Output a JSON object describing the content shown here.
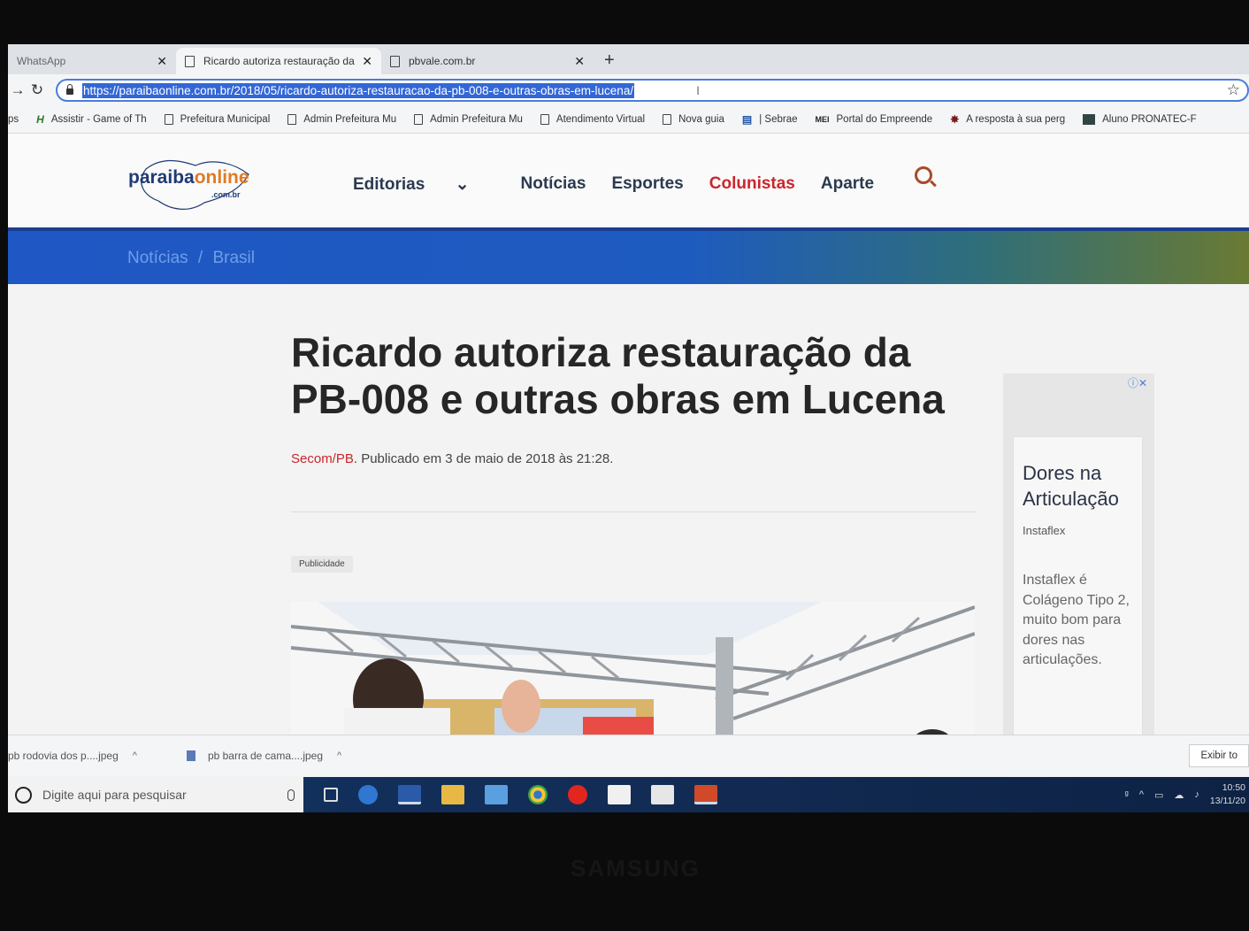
{
  "tabs": [
    {
      "label": "WhatsApp",
      "active": false
    },
    {
      "label": "Ricardo autoriza restauração da P",
      "active": true
    },
    {
      "label": "pbvale.com.br",
      "active": false
    }
  ],
  "address_bar": {
    "url": "https://paraibaonline.com.br/2018/05/ricardo-autoriza-restauracao-da-pb-008-e-outras-obras-em-lucena/"
  },
  "bookmarks": [
    {
      "icon": "apps-icon",
      "label": "ps"
    },
    {
      "icon": "h-icon",
      "label": "Assistir - Game of Th"
    },
    {
      "icon": "page-icon",
      "label": "Prefeitura Municipal"
    },
    {
      "icon": "page-icon",
      "label": "Admin Prefeitura Mu"
    },
    {
      "icon": "page-icon",
      "label": "Admin Prefeitura Mu"
    },
    {
      "icon": "page-icon",
      "label": "Atendimento Virtual"
    },
    {
      "icon": "page-icon",
      "label": "Nova guia"
    },
    {
      "icon": "sebrae-icon",
      "label": "| Sebrae"
    },
    {
      "icon": "mei-icon",
      "label": "Portal do Empreende"
    },
    {
      "icon": "sun-icon",
      "label": "A resposta à sua perg"
    },
    {
      "icon": "grid-icon",
      "label": "Aluno PRONATEC-F"
    }
  ],
  "site": {
    "logo": {
      "part1": "paraiba",
      "part2": "online",
      "suffix": ".com.br"
    },
    "nav": [
      {
        "label": "Editorias",
        "active": false
      },
      {
        "label": "Notícias",
        "active": false
      },
      {
        "label": "Esportes",
        "active": false
      },
      {
        "label": "Colunistas",
        "active": true
      },
      {
        "label": "Aparte",
        "active": false
      }
    ],
    "nav_dropdown_glyph": "⌄"
  },
  "breadcrumb": {
    "section": "Notícias",
    "separator": "/",
    "subsection": "Brasil"
  },
  "article": {
    "title": "Ricardo autoriza restauração da PB-008 e outras obras em Lucena",
    "author": "Secom/PB",
    "published": ". Publicado em 3 de maio de 2018 às 21:28.",
    "ad_label": "Publicidade"
  },
  "ad": {
    "title": "Dores na Articulação",
    "brand": "Instaflex",
    "body": "Instaflex é Colágeno Tipo 2, muito bom para dores nas articulações."
  },
  "downloads": [
    {
      "name": "pb rodovia dos p....jpeg"
    },
    {
      "name": "pb barra de cama....jpeg"
    }
  ],
  "downloads_show_all": "Exibir to",
  "taskbar": {
    "search_placeholder": "Digite aqui para pesquisar",
    "time": "10:50",
    "date": "13/11/20"
  },
  "monitor_brand": "SAMSUNG",
  "colors": {
    "accent_red": "#c9262e",
    "nav_text": "#2b3a4e",
    "band_blue": "#1f57c4",
    "url_selection": "#3367d6"
  }
}
